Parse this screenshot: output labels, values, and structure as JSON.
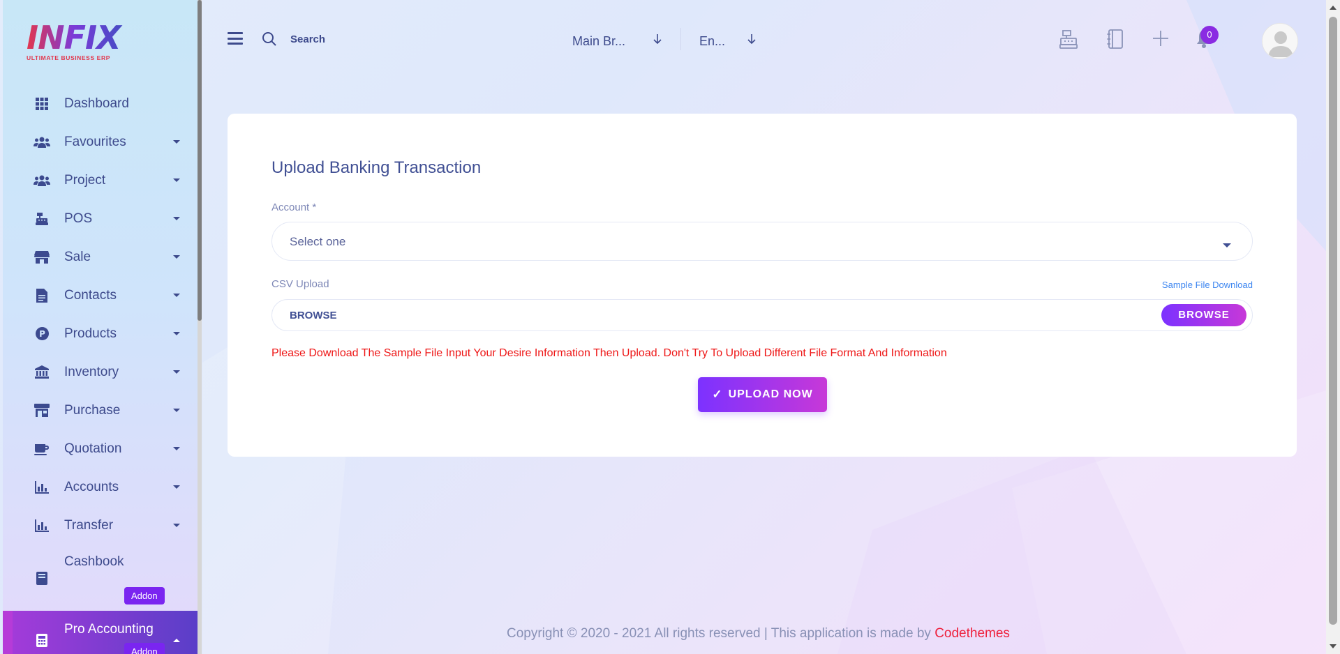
{
  "brand": {
    "logo_text": "INFIX",
    "tagline": "ULTIMATE BUSINESS ERP"
  },
  "sidebar": {
    "items": [
      {
        "label": "Dashboard",
        "icon": "grid-icon",
        "has_caret": false
      },
      {
        "label": "Favourites",
        "icon": "users-icon",
        "has_caret": true
      },
      {
        "label": "Project",
        "icon": "users-icon",
        "has_caret": true
      },
      {
        "label": "POS",
        "icon": "cash-register-icon",
        "has_caret": true
      },
      {
        "label": "Sale",
        "icon": "store-icon",
        "has_caret": true
      },
      {
        "label": "Contacts",
        "icon": "address-book-icon",
        "has_caret": true
      },
      {
        "label": "Products",
        "icon": "product-p-icon",
        "has_caret": true
      },
      {
        "label": "Inventory",
        "icon": "bank-icon",
        "has_caret": true
      },
      {
        "label": "Purchase",
        "icon": "shop-icon",
        "has_caret": true
      },
      {
        "label": "Quotation",
        "icon": "coffee-icon",
        "has_caret": true
      },
      {
        "label": "Accounts",
        "icon": "bar-chart-icon",
        "has_caret": true
      },
      {
        "label": "Transfer",
        "icon": "bar-chart-icon",
        "has_caret": true
      },
      {
        "label": "Cashbook",
        "icon": "book-icon",
        "has_caret": false,
        "badge": "Addon"
      },
      {
        "label": "Pro Accounting",
        "icon": "calculator-icon",
        "has_caret": true,
        "badge": "Addon",
        "active": true
      }
    ]
  },
  "header": {
    "search_label": "Search",
    "branch_select": "Main Br...",
    "language_select": "En...",
    "notification_count": "0"
  },
  "form": {
    "title": "Upload Banking Transaction",
    "account_label": "Account *",
    "account_value": "Select one",
    "csv_label": "CSV Upload",
    "sample_link": "Sample File Download",
    "file_value": "BROWSE",
    "browse_button": "BROWSE",
    "warning": "Please Download The Sample File Input Your Desire Information Then Upload. Don't Try To Upload Different File Format And Information",
    "upload_button": "UPLOAD NOW"
  },
  "footer": {
    "text": "Copyright © 2020 - 2021 All rights reserved | This application is made by ",
    "brand": "Codethemes"
  },
  "colors": {
    "accent": "#7c32ff",
    "accent_end": "#c738d8",
    "text_primary": "#415094",
    "warning": "#ee1616",
    "link": "#3d86f0",
    "footer_brand": "#ee1f3b"
  }
}
